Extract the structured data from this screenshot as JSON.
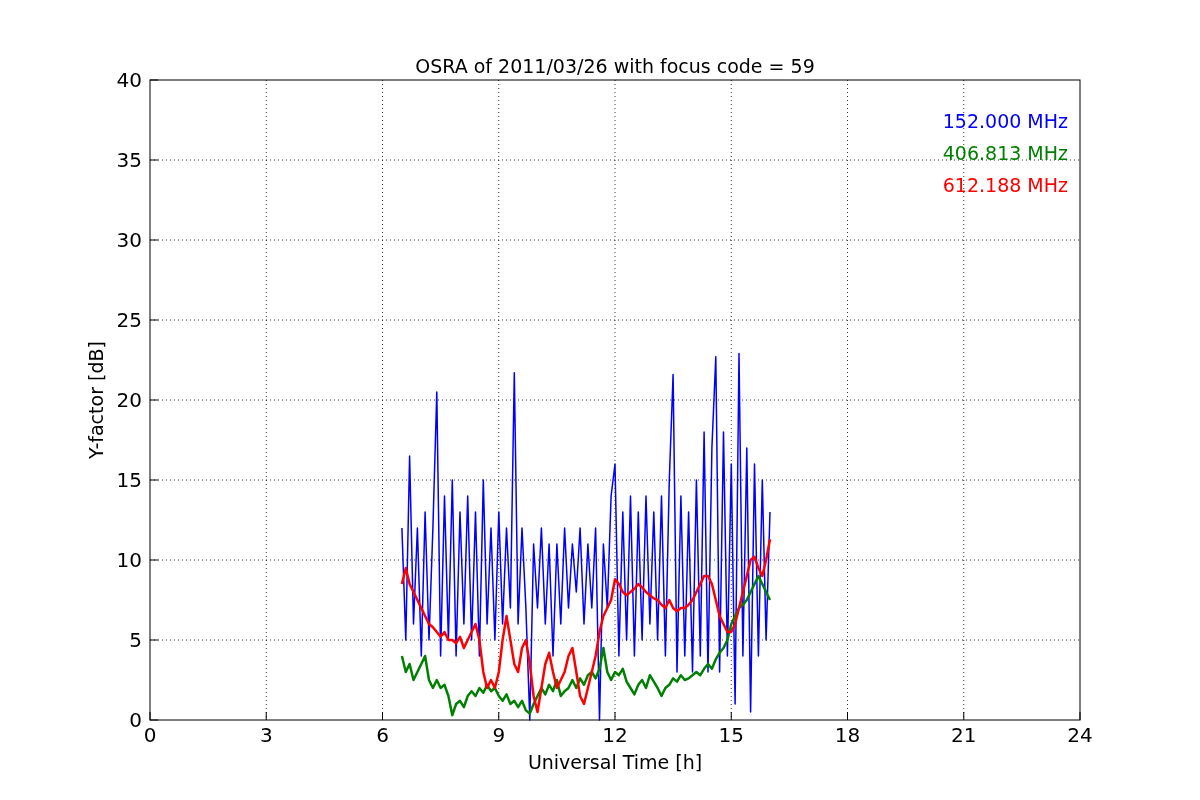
{
  "chart_data": {
    "type": "line",
    "title": "OSRA of 2011/03/26 with focus code = 59",
    "xlabel": "Universal Time [h]",
    "ylabel": "Y-factor [dB]",
    "x": [
      6.5,
      6.6,
      6.7,
      6.8,
      6.9,
      7.0,
      7.1,
      7.2,
      7.3,
      7.4,
      7.5,
      7.6,
      7.7,
      7.8,
      7.9,
      8.0,
      8.1,
      8.2,
      8.3,
      8.4,
      8.5,
      8.6,
      8.7,
      8.8,
      8.9,
      9.0,
      9.1,
      9.2,
      9.3,
      9.4,
      9.5,
      9.6,
      9.7,
      9.8,
      9.9,
      10.0,
      10.1,
      10.2,
      10.3,
      10.4,
      10.5,
      10.6,
      10.7,
      10.8,
      10.9,
      11.0,
      11.1,
      11.2,
      11.3,
      11.4,
      11.5,
      11.6,
      11.7,
      11.8,
      11.9,
      12.0,
      12.1,
      12.2,
      12.3,
      12.4,
      12.5,
      12.6,
      12.7,
      12.8,
      12.9,
      13.0,
      13.1,
      13.2,
      13.3,
      13.4,
      13.5,
      13.6,
      13.7,
      13.8,
      13.9,
      14.0,
      14.1,
      14.2,
      14.3,
      14.4,
      14.5,
      14.6,
      14.7,
      14.8,
      14.9,
      15.0,
      15.1,
      15.2,
      15.3,
      15.4,
      15.5,
      15.6,
      15.7,
      15.8,
      15.9,
      16.0
    ],
    "series": [
      {
        "name": "152.000 MHz",
        "color": "#0000ff",
        "values": [
          12,
          5,
          16.5,
          6,
          12,
          4,
          13,
          5,
          12,
          20.5,
          4,
          14,
          5,
          15,
          4,
          13,
          6,
          14,
          5,
          13,
          4,
          15,
          6,
          12,
          5,
          13,
          6,
          12,
          7,
          21.7,
          6,
          12,
          7,
          0,
          11,
          7,
          12,
          6,
          11,
          4,
          11,
          6,
          12,
          7,
          11,
          8,
          12,
          6,
          11,
          7,
          12,
          0,
          11,
          7,
          14,
          16,
          4,
          13,
          5,
          14,
          4,
          13,
          5,
          14,
          6,
          13,
          5,
          14,
          4,
          15,
          21.6,
          3,
          14,
          4,
          13,
          3,
          15,
          4,
          18,
          3,
          17,
          22.7,
          3,
          18,
          4,
          16,
          1,
          22.9,
          4,
          17,
          0.5,
          16,
          4,
          15,
          5,
          13
        ]
      },
      {
        "name": "406.813 MHz",
        "color": "#008000",
        "values": [
          4,
          3,
          3.5,
          2.5,
          3,
          3.5,
          4,
          2.5,
          2,
          2.5,
          2,
          2.2,
          1.5,
          0.3,
          1,
          1.2,
          0.8,
          1.5,
          1.8,
          1.5,
          2,
          1.7,
          2.2,
          1.8,
          2,
          1.5,
          1.2,
          1.6,
          1,
          1.2,
          0.8,
          1.2,
          0.6,
          0.4,
          1,
          1.5,
          2,
          1.6,
          2.2,
          1.8,
          2.5,
          1.5,
          1.8,
          2,
          2.5,
          2,
          2.6,
          2.2,
          2.8,
          3,
          2.6,
          3.2,
          4.5,
          3,
          2.5,
          3,
          2.8,
          3.2,
          2.4,
          2,
          1.6,
          2.2,
          2.5,
          2,
          2.8,
          2.4,
          2,
          1.5,
          2,
          2.2,
          2.6,
          2.4,
          2.8,
          2.5,
          2.6,
          2.8,
          3,
          2.8,
          3.2,
          3.5,
          3.2,
          3.8,
          4.2,
          4.5,
          5,
          6,
          6.5,
          7,
          7.2,
          7.5,
          8,
          8.5,
          9,
          8.5,
          8,
          7.5
        ]
      },
      {
        "name": "612.188 MHz",
        "color": "#ff0000",
        "values": [
          8.5,
          9.5,
          8.5,
          8,
          7.5,
          7,
          6.5,
          6,
          5.8,
          5.5,
          5.2,
          5.5,
          5,
          5,
          4.8,
          5.2,
          4.5,
          5,
          5.5,
          6,
          5,
          3,
          2,
          2.5,
          2,
          3,
          5,
          6.5,
          5,
          3.5,
          3,
          4.5,
          5,
          3.5,
          1.5,
          0.5,
          2,
          3.5,
          4.2,
          3,
          2,
          2.5,
          3,
          4,
          4.5,
          3,
          1.5,
          1,
          2,
          3,
          4,
          5.5,
          6.5,
          7,
          7.5,
          8.8,
          8.5,
          8,
          7.8,
          8,
          8.2,
          8.5,
          8.3,
          8,
          7.8,
          7.6,
          7.5,
          7.2,
          7,
          7.5,
          7,
          6.8,
          7,
          7,
          7.2,
          7.5,
          8,
          8.5,
          9,
          9,
          8.5,
          7.5,
          6.5,
          6,
          5.5,
          5.5,
          6,
          7,
          8,
          9,
          10,
          10.2,
          9.5,
          9,
          10,
          11.3
        ]
      }
    ],
    "grid": true,
    "xlim": [
      0,
      24
    ],
    "ylim": [
      0,
      40
    ],
    "xticks": [
      0,
      3,
      6,
      9,
      12,
      15,
      18,
      21,
      24
    ],
    "yticks": [
      0,
      5,
      10,
      15,
      20,
      25,
      30,
      35,
      40
    ]
  }
}
